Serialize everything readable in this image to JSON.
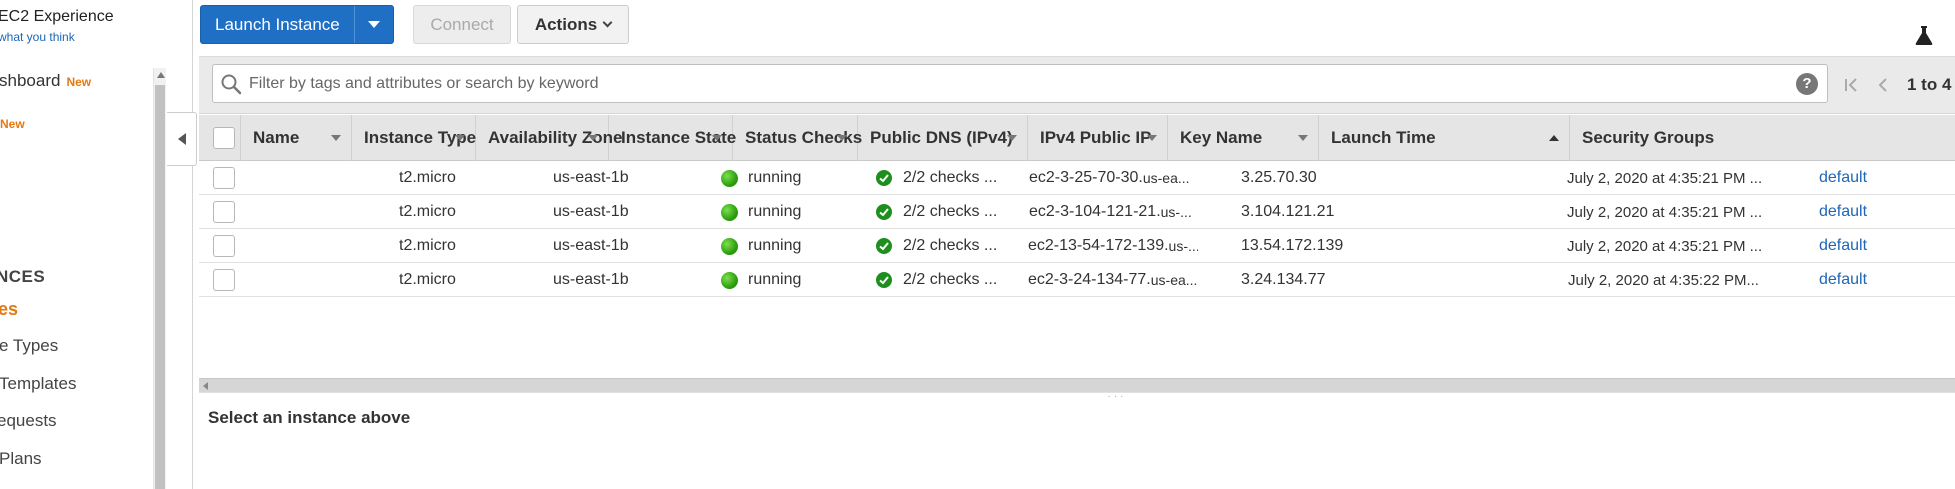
{
  "sidebar": {
    "title": "EC2 Experience",
    "feedback": "what you think",
    "dashboard_label": "shboard",
    "new_badge": "New",
    "section_header": "NCES",
    "items": [
      {
        "label": "es"
      },
      {
        "label": "e Types"
      },
      {
        "label": "Templates"
      },
      {
        "label": "equests"
      },
      {
        "label": "Plans"
      }
    ]
  },
  "toolbar": {
    "launch_label": "Launch Instance",
    "connect_label": "Connect",
    "actions_label": "Actions"
  },
  "filter": {
    "placeholder": "Filter by tags and attributes or search by keyword",
    "help": "?",
    "page_count": "1 to 4"
  },
  "table": {
    "columns": [
      "Name",
      "Instance Type",
      "Availability Zone",
      "Instance State",
      "Status Checks",
      "Public DNS (IPv4)",
      "IPv4 Public IP",
      "Key Name",
      "Launch Time",
      "Security Groups"
    ],
    "rows": [
      {
        "name": "",
        "type": "t2.micro",
        "az": "us-east-1b",
        "state": "running",
        "checks": "2/2 checks ...",
        "dns_main": "ec2-3-25-70-30.",
        "dns_rest": "us-ea...",
        "ip": "3.25.70.30",
        "key": "",
        "launch": "July 2, 2020 at 4:35:21 PM ...",
        "sg": "default"
      },
      {
        "name": "",
        "type": "t2.micro",
        "az": "us-east-1b",
        "state": "running",
        "checks": "2/2 checks ...",
        "dns_main": "ec2-3-104-121-21.",
        "dns_rest": "us-...",
        "ip": "3.104.121.21",
        "key": "",
        "launch": "July 2, 2020 at 4:35:21 PM ...",
        "sg": "default"
      },
      {
        "name": "",
        "type": "t2.micro",
        "az": "us-east-1b",
        "state": "running",
        "checks": "2/2 checks ...",
        "dns_main": "ec2-13-54-172-139.",
        "dns_rest": "us-...",
        "ip": "13.54.172.139",
        "key": "",
        "launch": "July 2, 2020 at 4:35:21 PM ...",
        "sg": "default"
      },
      {
        "name": "",
        "type": "t2.micro",
        "az": "us-east-1b",
        "state": "running",
        "checks": "2/2 checks ...",
        "dns_main": "ec2-3-24-134-77.",
        "dns_rest": "us-ea...",
        "ip": "3.24.134.77",
        "key": "",
        "launch": "July 2, 2020 at 4:35:22 PM...",
        "sg": "default"
      }
    ]
  },
  "detail": {
    "message": "Select an instance above"
  },
  "colors": {
    "primary": "#1f6fc5",
    "link": "#1e66b6",
    "accent_orange": "#e47911",
    "running_green": "#2e9e10"
  },
  "icons": [
    "search-icon",
    "help-icon",
    "flask-icon",
    "first-page-icon",
    "prev-page-icon",
    "check-icon",
    "status-dot-icon",
    "chevron-down-icon",
    "sort-icon"
  ]
}
